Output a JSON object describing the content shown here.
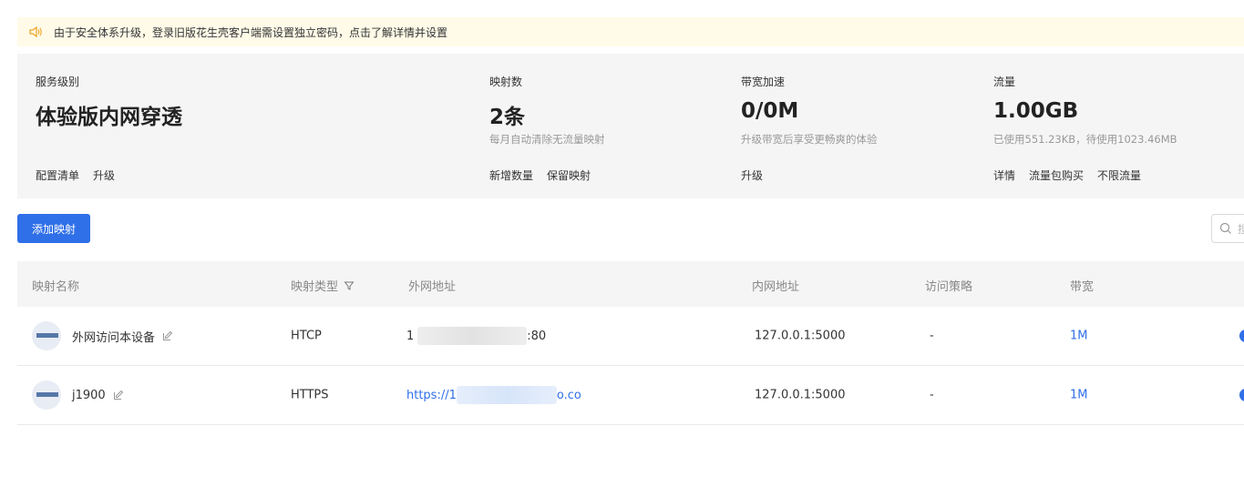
{
  "notice": {
    "text": "由于安全体系升级，登录旧版花生壳客户端需设置独立密码，点击了解详情并设置"
  },
  "stats": {
    "service": {
      "label": "服务级别",
      "value": "体验版内网穿透",
      "links": [
        "配置清单",
        "升级"
      ]
    },
    "mappings": {
      "label": "映射数",
      "value": "2条",
      "sub": "每月自动清除无流量映射",
      "links": [
        "新增数量",
        "保留映射"
      ]
    },
    "bandwidth": {
      "label": "带宽加速",
      "value": "0/0M",
      "sub": "升级带宽后享受更畅爽的体验",
      "links": [
        "升级"
      ]
    },
    "traffic": {
      "label": "流量",
      "value": "1.00GB",
      "sub": "已使用551.23KB，待使用1023.46MB",
      "links": [
        "详情",
        "流量包购买",
        "不限流量"
      ]
    }
  },
  "toolbar": {
    "add_button": "添加映射",
    "search_placeholder": "搜"
  },
  "table": {
    "headers": [
      "映射名称",
      "映射类型",
      "外网地址",
      "内网地址",
      "访问策略",
      "带宽"
    ],
    "rows": [
      {
        "name": "外网访问本设备",
        "type": "HTCP",
        "external_prefix": "1",
        "external_suffix": ":80",
        "internal": "127.0.0.1:5000",
        "policy": "-",
        "bandwidth": "1M"
      },
      {
        "name": "j1900",
        "type": "HTTPS",
        "external_prefix": "https://1",
        "external_suffix": "o.co",
        "internal": "127.0.0.1:5000",
        "policy": "-",
        "bandwidth": "1M"
      }
    ]
  },
  "colors": {
    "primary": "#2f6fe8",
    "notice_bg": "#fffbe8",
    "panel_bg": "#f5f5f6"
  },
  "icons": {
    "notice": "speaker-icon",
    "search": "search-icon",
    "filter": "filter-icon",
    "edit": "edit-icon"
  }
}
